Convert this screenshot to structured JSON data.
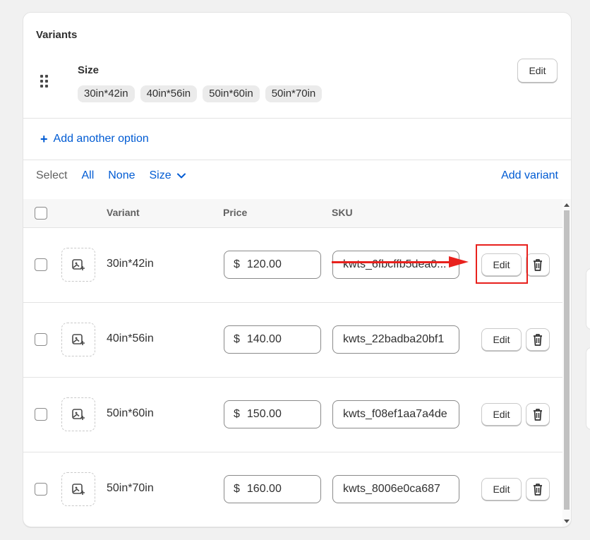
{
  "section": {
    "title": "Variants",
    "option": {
      "name": "Size",
      "values": [
        "30in*42in",
        "40in*56in",
        "50in*60in",
        "50in*70in"
      ],
      "edit_label": "Edit"
    },
    "add_option_label": "Add another option"
  },
  "select_bar": {
    "label": "Select",
    "all": "All",
    "none": "None",
    "size": "Size",
    "add_variant": "Add variant"
  },
  "table": {
    "headers": {
      "variant": "Variant",
      "price": "Price",
      "sku": "SKU"
    },
    "currency_symbol": "$",
    "edit_label": "Edit",
    "rows": [
      {
        "variant": "30in*42in",
        "price": "120.00",
        "sku": "kwts_6fbcffb5dea0..."
      },
      {
        "variant": "40in*56in",
        "price": "140.00",
        "sku": "kwts_22badba20bf1"
      },
      {
        "variant": "50in*60in",
        "price": "150.00",
        "sku": "kwts_f08ef1aa7a4de"
      },
      {
        "variant": "50in*70in",
        "price": "160.00",
        "sku": "kwts_8006e0ca687"
      }
    ]
  },
  "colors": {
    "link": "#005bd3",
    "annotation": "#e8211d"
  }
}
